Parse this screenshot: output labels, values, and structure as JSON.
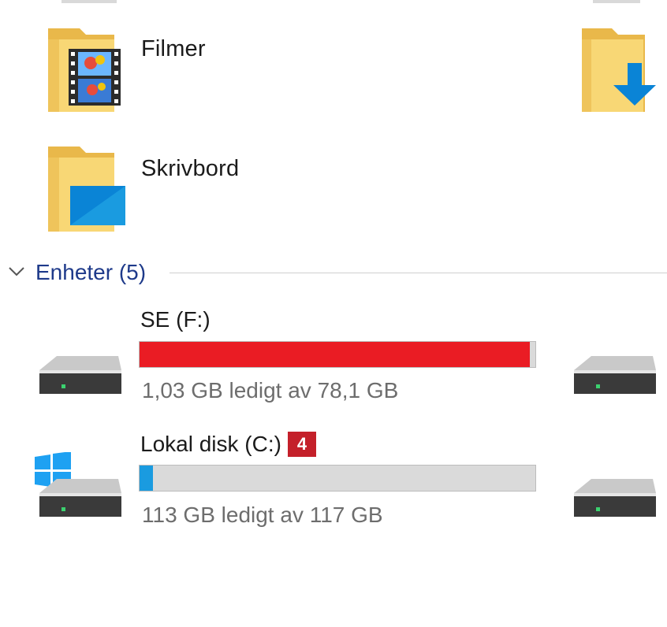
{
  "folders": [
    {
      "label": "Filmer",
      "icon": "videos-folder-icon"
    },
    {
      "label": "Skrivbord",
      "icon": "desktop-folder-icon"
    }
  ],
  "right_folder": {
    "icon": "downloads-folder-icon"
  },
  "devices_section": {
    "title": "Enheter (5)",
    "icon": "chevron-down-icon"
  },
  "drives": [
    {
      "name": "SE (F:)",
      "free_text": "1,03 GB ledigt av 78,1 GB",
      "used_fraction": 0.987,
      "bar_color": "#ea1c24",
      "icon": "hard-drive-icon"
    },
    {
      "name": "Lokal disk (C:)",
      "badge": "4",
      "free_text": "113 GB ledigt av 117 GB",
      "used_fraction": 0.034,
      "bar_color": "#1a9be0",
      "icon": "windows-drive-icon"
    }
  ],
  "colors": {
    "section_title": "#1e3a8a",
    "folder_yellow": "#f8d775",
    "accent_blue": "#0a84d6",
    "badge_red": "#c4202a"
  }
}
